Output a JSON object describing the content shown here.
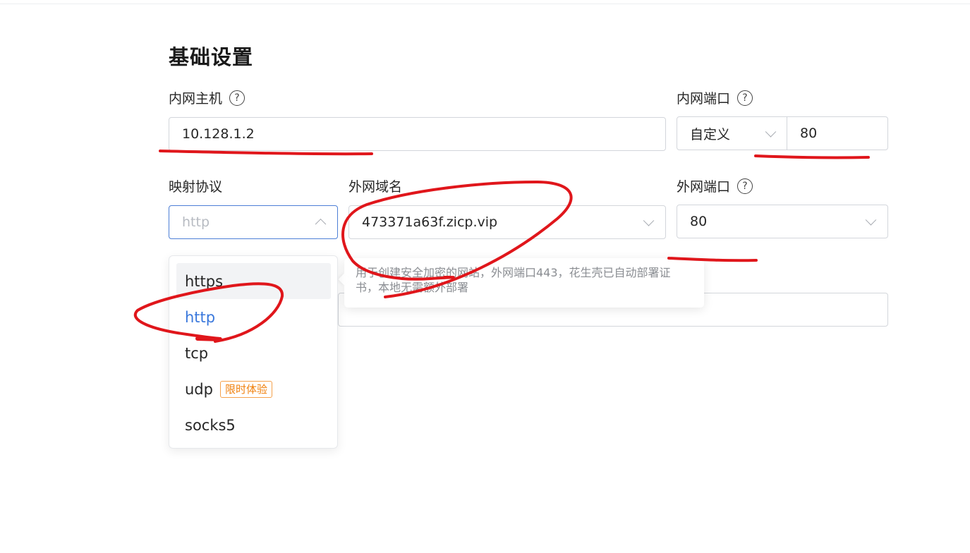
{
  "section": {
    "title": "基础设置"
  },
  "internal_host": {
    "label": "内网主机",
    "value": "10.128.1.2"
  },
  "internal_port": {
    "label": "内网端口",
    "mode": "自定义",
    "value": "80"
  },
  "protocol": {
    "label": "映射协议",
    "placeholder": "http",
    "options": [
      {
        "label": "https"
      },
      {
        "label": "http"
      },
      {
        "label": "tcp"
      },
      {
        "label": "udp",
        "badge": "限时体验"
      },
      {
        "label": "socks5"
      }
    ]
  },
  "domain": {
    "label": "外网域名",
    "value": "473371a63f.zicp.vip",
    "tooltip": "用于创建安全加密的网站，外网端口443，花生壳已自动部署证书，本地无需额外部署"
  },
  "external_port": {
    "label": "外网端口",
    "value": "80"
  },
  "help_icon": "?",
  "colors": {
    "accent": "#3a78dc",
    "badge": "#f0800c",
    "annotation": "#e0161b"
  }
}
